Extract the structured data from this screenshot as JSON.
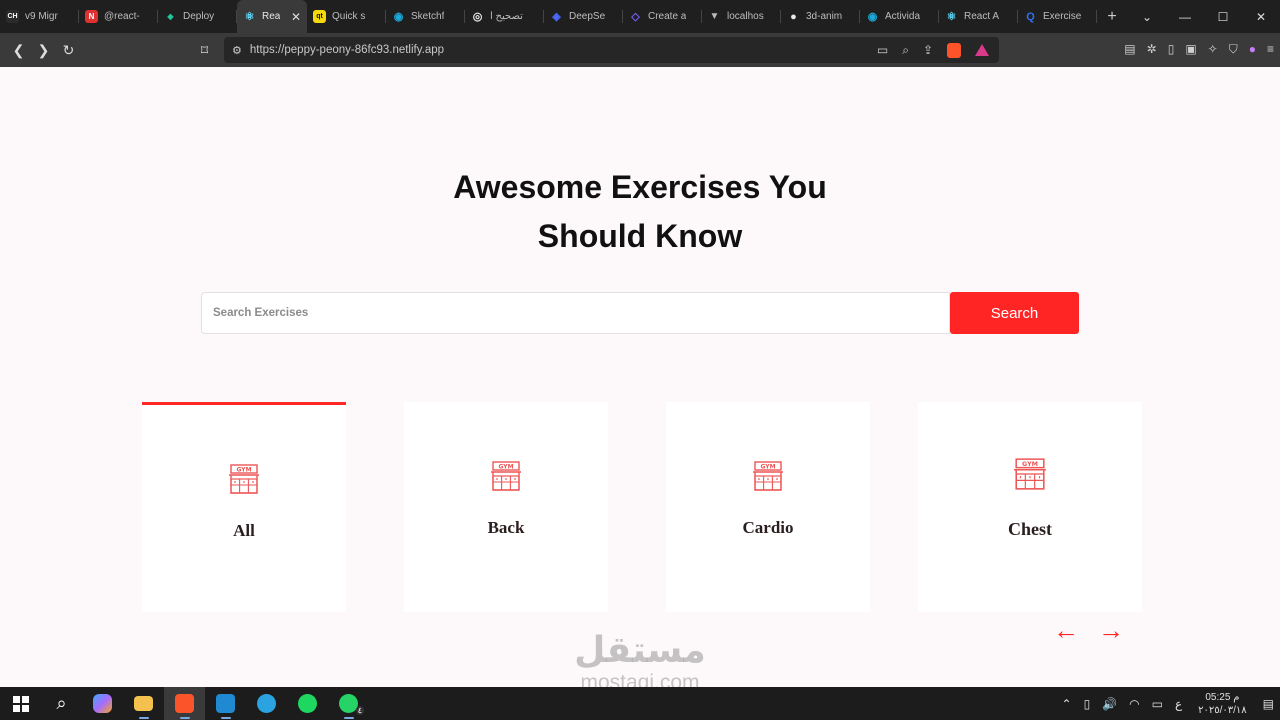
{
  "browser": {
    "tabs": [
      {
        "label": "v9 Migr",
        "favicon": "CH",
        "color": "#2b2b2b"
      },
      {
        "label": "@react-",
        "favicon": "N",
        "color": "#e03131"
      },
      {
        "label": "Deploy",
        "favicon": "◆",
        "color": "#25c2a0"
      },
      {
        "label": "Rea",
        "favicon": "⚛",
        "color": "#61dafb",
        "active": true
      },
      {
        "label": "Quick s",
        "favicon": "qt",
        "color": "#f5d90a"
      },
      {
        "label": "Sketchf",
        "favicon": "◉",
        "color": "#1caad9"
      },
      {
        "label": "تصحيح أ",
        "favicon": "◎",
        "color": "#e8e8e8"
      },
      {
        "label": "DeepSe",
        "favicon": "◈",
        "color": "#4d6bfe"
      },
      {
        "label": "Create a",
        "favicon": "◇",
        "color": "#7b5cff"
      },
      {
        "label": "localhos",
        "favicon": "▼",
        "color": "#bbbbbb"
      },
      {
        "label": "3d-anim",
        "favicon": "●",
        "color": "#e8e8e8"
      },
      {
        "label": "Activida",
        "favicon": "◉",
        "color": "#1caad9"
      },
      {
        "label": "React A",
        "favicon": "⚛",
        "color": "#61dafb"
      },
      {
        "label": "Exercise",
        "favicon": "Q",
        "color": "#2f6fed"
      }
    ],
    "new_tab": "+",
    "url": "https://peppy-peony-86fc93.netlify.app"
  },
  "page": {
    "title_line1": "Awesome Exercises You",
    "title_line2": "Should Know",
    "search": {
      "placeholder": "Search Exercises",
      "value": "",
      "button_label": "Search"
    },
    "categories": [
      {
        "name": "All",
        "icon": "gym-icon",
        "selected": true
      },
      {
        "name": "Back",
        "icon": "gym-icon",
        "selected": false
      },
      {
        "name": "Cardio",
        "icon": "gym-icon",
        "selected": false
      },
      {
        "name": "Chest",
        "icon": "gym-icon",
        "selected": false
      }
    ],
    "prev_arrow": "←",
    "next_arrow": "→",
    "accent_color": "#ff2625"
  },
  "watermark": {
    "arabic": "مستقل",
    "latin": "mostaqi.com"
  },
  "taskbar": {
    "time": "05:25 م",
    "date": "٢٠٢٥/٠٣/١٨",
    "lang": "ع",
    "whatsapp_badge": "٤"
  }
}
